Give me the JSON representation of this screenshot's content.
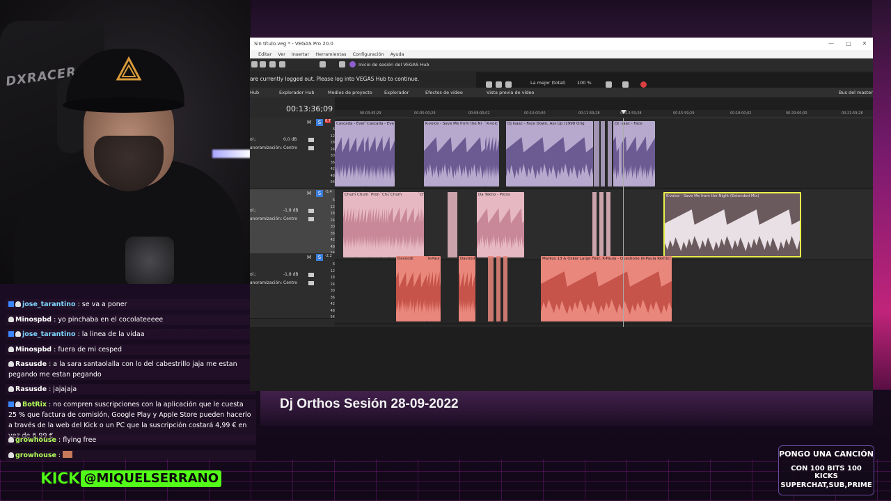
{
  "vegas": {
    "title": "Sin título.veg * - VEGAS Pro 20.0",
    "menu": [
      "Editar",
      "Ver",
      "Insertar",
      "Herramientas",
      "Configuración",
      "Ayuda"
    ],
    "hub_login": "Inicio de sesión del VEGAS Hub",
    "hub_message": "are currently logged out. Please log into VEGAS Hub to continue.",
    "tabs": [
      "Hub",
      "Explorador Hub",
      "Medios de proyecto",
      "Explorador",
      "Efectos de vídeo",
      "Vista previa de vídeo",
      "Bus del master"
    ],
    "preview_quality": "La mejor (total)",
    "preview_zoom": "100 %",
    "timecode": "00:13:36;09",
    "ruler_marks": [
      "00:03:45;29",
      "00:05:00;29",
      "00:08:00;02",
      "00:10:00;00",
      "00:11:59;28",
      "00:13:59;28",
      "00:15:59;29",
      "00:18:00;02",
      "00:20:00;00",
      "00:21:59;28"
    ],
    "db_scale": [
      "6",
      "12",
      "18",
      "24",
      "30",
      "36",
      "42",
      "48",
      "54"
    ],
    "tracks": [
      {
        "m": "M",
        "s": "S",
        "peak": "0,7",
        "vol_label": "ol.:",
        "vol": "0,0 dB",
        "pan_label": "anoramización:",
        "pan": "Centro",
        "clips": [
          "Cascada - Every",
          "Cascada - Eve",
          "K-voice - Save Me from the Ni",
          "K-voic",
          "DJ Isaac - Face Down, Ass Up (1998 Orig",
          "DJ Isaac - Face"
        ]
      },
      {
        "m": "M",
        "s": "S",
        "peak": "-5,4",
        "vol_label": "ol.:",
        "vol": "-1,8 dB",
        "pan_label": "anoramización:",
        "pan": "Centro",
        "clips": [
          "Chum",
          "Chum",
          "Pron",
          "Chum",
          "Chum",
          "Da Tekno - Prons",
          "Ch",
          "K-voice - Save Me from the Night (Extended Mix)"
        ]
      },
      {
        "m": "M",
        "s": "S",
        "peak": "-2,2",
        "vol_label": "ol.:",
        "vol": "-1,8 dB",
        "pan_label": "anoramización:",
        "pan": "Centro",
        "clips": [
          "Davoodi",
          "K-Paul",
          "Davood",
          "Markus 13 & Oskar Large Feat. K-Paula - Questione (K-Paula Remix)"
        ]
      }
    ]
  },
  "chat": [
    {
      "user": "jose_tarantino",
      "text": ": se va a poner",
      "color": "#7fd6ff",
      "badge": true
    },
    {
      "user": "Minospbd",
      "text": ": yo pinchaba en el cocolateeeee",
      "color": "#ffffff",
      "badge": false
    },
    {
      "user": "jose_tarantino",
      "text": ": la linea de la vidaa",
      "color": "#7fd6ff",
      "badge": true
    },
    {
      "user": "Minospbd",
      "text": ": fuera de mi cesped",
      "color": "#ffffff",
      "badge": false
    },
    {
      "user": "Rasusde",
      "text": ": a la sara santaolalla con lo del cabestrillo jaja me estan pegando me estan pegando",
      "color": "#ffffff",
      "badge": false
    },
    {
      "user": "Rasusde",
      "text": ": jajajaja",
      "color": "#ffffff",
      "badge": false
    },
    {
      "user": "BotRix",
      "text": ": no compren suscripciones con la aplicación que le cuesta 25 % que factura de comisión, Google Play y Apple Store pueden hacerlo a través de la web del Kick o un PC que la suscripción costará 4,99 € en vez de 6,99 €",
      "color": "#b2ff59",
      "badge": true
    },
    {
      "user": "growhouse",
      "text": ": flying free",
      "color": "#b2ff59",
      "badge": false
    },
    {
      "user": "growhouse",
      "text": ":",
      "color": "#b2ff59",
      "badge": false
    }
  ],
  "stream_title": "Dj Orthos Sesión 28-09-2022",
  "kick": {
    "brand": "KICK",
    "handle": "@MIQUELSERRANO"
  },
  "promo": {
    "line1": "PONGO UNA CANCIÓN",
    "line2": "CON 100 BITS 100 KICKS",
    "line3": "SUPERCHAT,SUB,PRIME"
  },
  "webcam": {
    "chair_brand": "DXRACER"
  },
  "colors": {
    "kick_green": "#53fc18",
    "track1_clip": "#b7a9cd",
    "track2_clip": "#e6b9c2",
    "track3_clip": "#e9877d",
    "selected_clip_border": "#e8f04a",
    "solo_blue": "#3b7dd8"
  }
}
